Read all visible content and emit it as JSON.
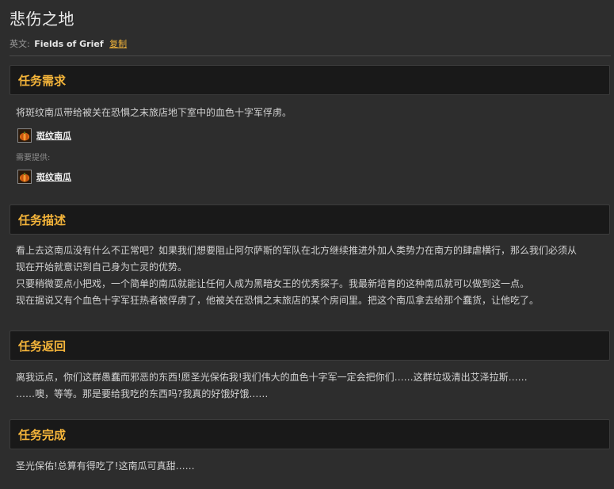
{
  "title": "悲伤之地",
  "english": {
    "label": "英文:",
    "name": "Fields of Grief",
    "copy": "复制"
  },
  "requirements": {
    "heading": "任务需求",
    "text": "将斑纹南瓜带给被关在恐惧之末旅店地下室中的血色十字军俘虏。",
    "item": "斑纹南瓜",
    "provided_label": "需要提供:",
    "provided_item": "斑纹南瓜"
  },
  "description": {
    "heading": "任务描述",
    "lines": [
      "看上去这南瓜没有什么不正常吧？如果我们想要阻止阿尔萨斯的军队在北方继续推进外加人类势力在南方的肆虐横行，那么我们必须从",
      "现在开始就意识到自己身为亡灵的优势。",
      "只要稍微耍点小把戏，一个简单的南瓜就能让任何人成为黑暗女王的优秀探子。我最新培育的这种南瓜就可以做到这一点。",
      "现在据说又有个血色十字军狂热者被俘虏了，他被关在恐惧之末旅店的某个房间里。把这个南瓜拿去给那个蠢货，让他吃了。"
    ]
  },
  "progress": {
    "heading": "任务返回",
    "lines": [
      "离我远点，你们这群愚蠢而邪恶的东西!愿圣光保佑我!我们伟大的血色十字军一定会把你们……这群垃圾清出艾泽拉斯……",
      "……噢，等等。那是要给我吃的东西吗?我真的好饿好饿……"
    ]
  },
  "completion": {
    "heading": "任务完成",
    "text": "圣光保佑!总算有得吃了!这南瓜可真甜……"
  },
  "icons": {
    "item_icon": "pumpkin-icon"
  }
}
